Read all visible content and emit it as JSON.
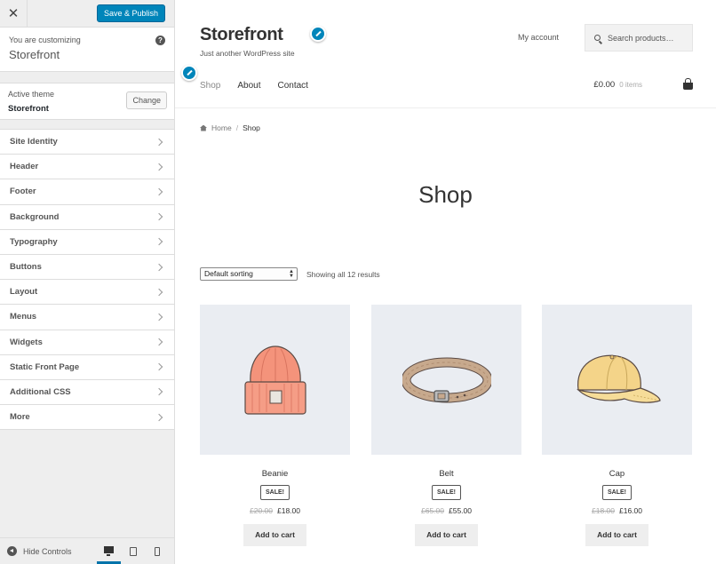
{
  "customizer": {
    "close_icon": "close-icon",
    "publish_label": "Save & Publish",
    "customizing_label": "You are customizing",
    "customizing_title": "Storefront",
    "active_theme_label": "Active theme",
    "active_theme_name": "Storefront",
    "change_label": "Change",
    "sections": [
      {
        "label": "Site Identity"
      },
      {
        "label": "Header"
      },
      {
        "label": "Footer"
      },
      {
        "label": "Background"
      },
      {
        "label": "Typography"
      },
      {
        "label": "Buttons"
      },
      {
        "label": "Layout"
      },
      {
        "label": "Menus"
      },
      {
        "label": "Widgets"
      },
      {
        "label": "Static Front Page"
      },
      {
        "label": "Additional CSS"
      },
      {
        "label": "More"
      }
    ],
    "hide_controls_label": "Hide Controls",
    "devices": [
      "desktop",
      "tablet",
      "mobile"
    ],
    "accent_color": "#0085ba"
  },
  "site": {
    "title": "Storefront",
    "tagline": "Just another WordPress site",
    "my_account": "My account",
    "search_placeholder": "Search products…",
    "nav": [
      {
        "label": "Shop"
      },
      {
        "label": "About"
      },
      {
        "label": "Contact"
      }
    ],
    "cart_amount": "£0.00",
    "cart_items": "0 items",
    "breadcrumb": {
      "home": "Home",
      "sep": "/",
      "current": "Shop"
    },
    "page_heading": "Shop",
    "sorting_value": "Default sorting",
    "result_count": "Showing all 12 results",
    "products": [
      {
        "name": "Beanie",
        "badge": "SALE!",
        "old_price": "£20.00",
        "price": "£18.00",
        "button": "Add to cart"
      },
      {
        "name": "Belt",
        "badge": "SALE!",
        "old_price": "£65.00",
        "price": "£55.00",
        "button": "Add to cart"
      },
      {
        "name": "Cap",
        "badge": "SALE!",
        "old_price": "£18.00",
        "price": "£16.00",
        "button": "Add to cart"
      }
    ]
  }
}
